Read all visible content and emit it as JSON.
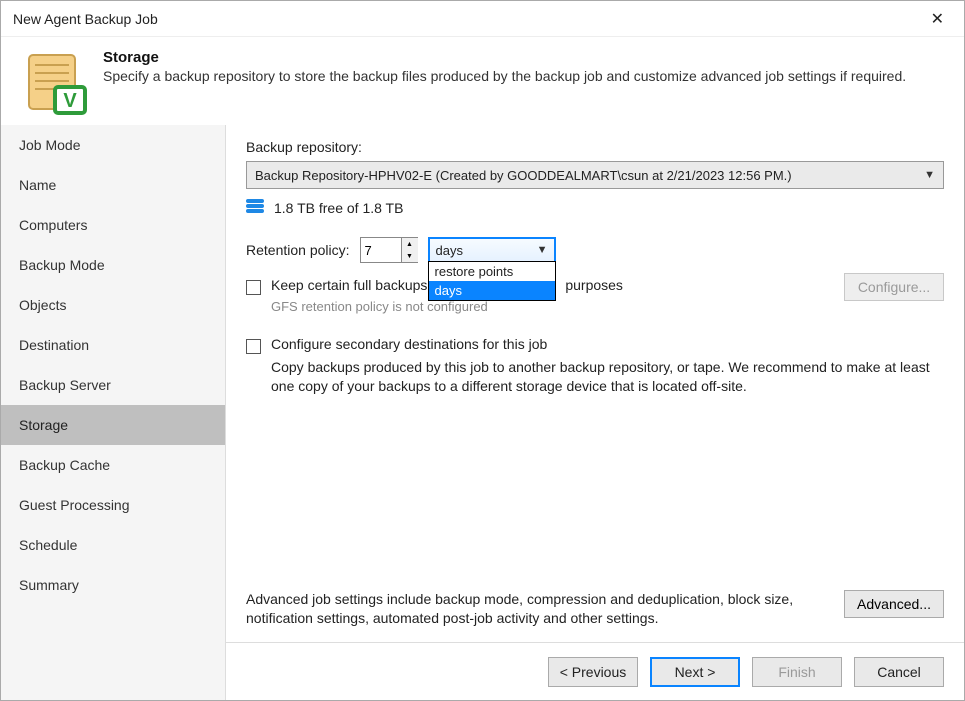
{
  "window": {
    "title": "New Agent Backup Job"
  },
  "header": {
    "heading": "Storage",
    "subheading": "Specify a backup repository to store the backup files produced by the backup job and customize advanced job settings if required."
  },
  "sidebar": {
    "items": [
      {
        "label": "Job Mode"
      },
      {
        "label": "Name"
      },
      {
        "label": "Computers"
      },
      {
        "label": "Backup Mode"
      },
      {
        "label": "Objects"
      },
      {
        "label": "Destination"
      },
      {
        "label": "Backup Server"
      },
      {
        "label": "Storage",
        "selected": true
      },
      {
        "label": "Backup Cache"
      },
      {
        "label": "Guest Processing"
      },
      {
        "label": "Schedule"
      },
      {
        "label": "Summary"
      }
    ]
  },
  "content": {
    "repo_label": "Backup repository:",
    "repo_value": "Backup Repository-HPHV02-E (Created by GOODDEALMART\\csun at 2/21/2023 12:56 PM.)",
    "free_text": "1.8 TB free of 1.8 TB",
    "retention_label": "Retention policy:",
    "retention_value": "7",
    "retention_unit": "days",
    "retention_options": [
      "restore points",
      "days"
    ],
    "gfs_label_before": "Keep certain full backups",
    "gfs_label_after": "purposes",
    "gfs_hint": "GFS retention policy is not configured",
    "configure_label": "Configure...",
    "secondary_label": "Configure secondary destinations for this job",
    "secondary_desc": "Copy backups produced by this job to another backup repository, or tape. We recommend to make at least one copy of your backups to a different storage device that is located off-site.",
    "advanced_text": "Advanced job settings include backup mode, compression and deduplication, block size, notification settings, automated post-job activity and other settings.",
    "advanced_label": "Advanced..."
  },
  "footer": {
    "previous": "< Previous",
    "next": "Next >",
    "finish": "Finish",
    "cancel": "Cancel"
  }
}
